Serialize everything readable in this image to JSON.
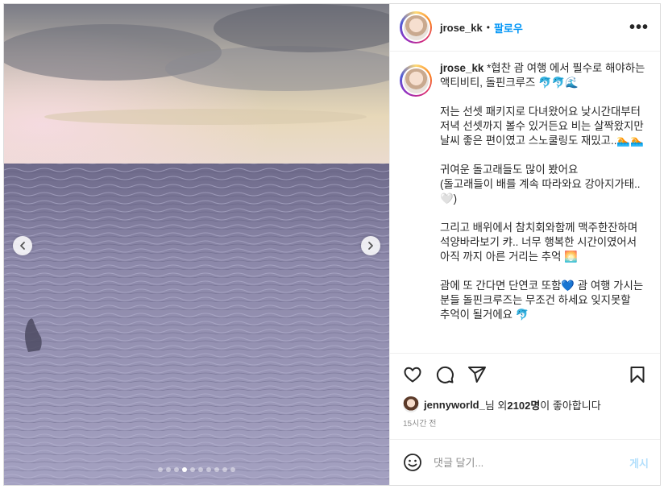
{
  "post": {
    "username": "jrose_kk",
    "separator": "•",
    "follow_label": "팔로우",
    "more_label": "•••",
    "caption": {
      "username": "jrose_kk",
      "text": " *협찬 괌 여행 에서 필수로 해야하는 액티비티, 돌핀크루즈 🐬🐬🌊\n\n저는 선셋 패키지로 다녀왔어요 낮시간대부터 저녁 선셋까지 볼수 있거든요 비는 살짝왔지만 날씨 좋은 편이였고 스노쿨링도 재밌고..🏊🏊\n\n귀여운 돌고래들도 많이 봤어요\n(돌고래들이 배를 계속 따라와요 강아지가태..🤍)\n\n그리고 배위에서 참치회와함께 맥주한잔하며 석양바라보기 캬.. 너무 행복한 시간이였어서 아직 까지 아른 거리는 추억 🌅\n\n괌에 또 간다면 단연코 또함💙 괌 여행 가시는 분들 돌핀크루즈는 무조건 하세요 잊지못할 추억이 될거에요 🐬"
    },
    "likes": {
      "liker": "jennyworld_",
      "text_middle": "님 외 ",
      "count": "2102명",
      "text_end": "이 좋아합니다"
    },
    "time_ago": "15시간 전",
    "comment": {
      "placeholder": "댓글 달기...",
      "post_label": "게시"
    },
    "carousel": {
      "total_slides": 10,
      "active_slide": 4
    }
  },
  "icons": {
    "prev": "chevron-left-icon",
    "next": "chevron-right-icon",
    "like": "heart-icon",
    "comment": "comment-bubble-icon",
    "share": "paper-plane-icon",
    "save": "bookmark-icon",
    "emoji": "smiley-icon"
  },
  "colors": {
    "follow": "#0095f6",
    "post_disabled": "#b2dffc",
    "muted": "#8e8e8e"
  }
}
